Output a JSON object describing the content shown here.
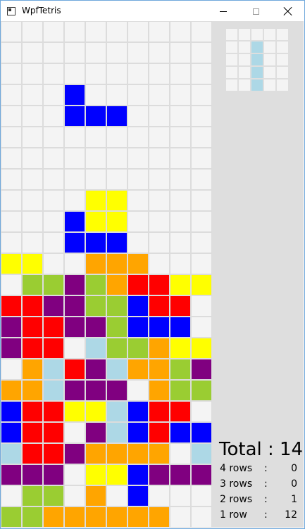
{
  "window": {
    "title": "WpfTetris",
    "minimize_icon": "minimize-icon",
    "maximize_icon": "maximize-icon",
    "close_icon": "close-icon"
  },
  "colors": {
    "empty": "#f4f4f4",
    "grid": "#dcdcdc",
    "side_bg": "#dedede",
    "B": "#0000ff",
    "Y": "#ffff00",
    "O": "#ffa500",
    "G": "#9acd32",
    "P": "#800080",
    "R": "#ff0000",
    "L": "#add8e6"
  },
  "board": {
    "cols": 10,
    "rows": 24,
    "cells": [
      "..........",
      "..........",
      "..........",
      "...B......",
      "...BBB....",
      "..........",
      "..........",
      "..........",
      "....YY....",
      "...BYY....",
      "...BBB....",
      "YY..OOO...",
      ".GGPGORRYY",
      "RRPPGGBRR.",
      "PRRPPGBBB.",
      "PRR.LGGOYY",
      ".OLRPLOOGP",
      "OOLPPP.OGG",
      "BRRYYLBRR.",
      "BRR.PLBRBB",
      "LRRPOOOO.L",
      "PPP.YYBPPP",
      ".GG.O.B...",
      "GGOOOOOO.."
    ]
  },
  "preview": {
    "cols": 5,
    "rows": 5,
    "cells": [
      ".....",
      "..L..",
      "..L..",
      "..L..",
      "..L.."
    ]
  },
  "score": {
    "total_label": "Total : 14",
    "rows": [
      {
        "label": "4 rows",
        "colon": ":",
        "value": "0"
      },
      {
        "label": "3 rows",
        "colon": ":",
        "value": "0"
      },
      {
        "label": "2 rows",
        "colon": ":",
        "value": "1"
      },
      {
        "label": "1 row",
        "colon": ":",
        "value": "12"
      }
    ]
  }
}
